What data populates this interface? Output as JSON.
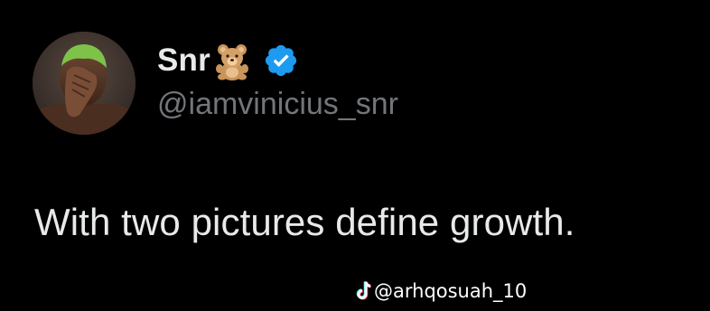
{
  "author": {
    "display_name": "Snr",
    "name_emoji": "teddy-bear-emoji",
    "verified": true,
    "verified_color": "#1d9bf0",
    "handle": "@iamvinicius_snr"
  },
  "tweet": {
    "text": "With two pictures define growth."
  },
  "watermark": {
    "icon": "tiktok-icon",
    "text": "@arhqosuah_10"
  },
  "colors": {
    "background": "#000000",
    "primary_text": "#e7e9ea",
    "secondary_text": "#71767b"
  }
}
